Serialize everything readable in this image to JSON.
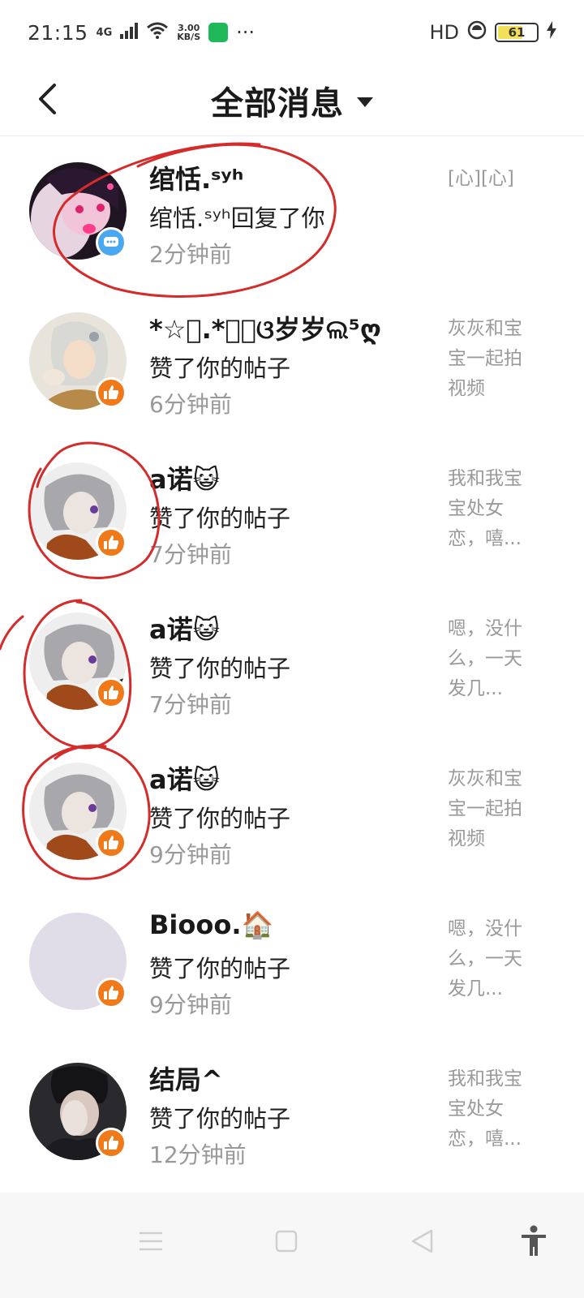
{
  "status_bar": {
    "time": "21:15",
    "network": "4G",
    "speed_value": "3.00",
    "speed_unit": "KB/S",
    "more": "···",
    "hd": "HD",
    "battery": "61"
  },
  "header": {
    "title": "全部消息"
  },
  "messages": [
    {
      "name": "绾恬.ˢʸʰ",
      "action": "绾恬.ˢʸʰ回复了你",
      "time": "2分钟前",
      "preview": "[心][心]",
      "badge": "comment-icon"
    },
    {
      "name": "*☆ﾟ.*･｡ଓ岁岁ଲ⁵ღ",
      "action": "赞了你的帖子",
      "time": "6分钟前",
      "preview": "灰灰和宝宝一起拍视频",
      "badge": "thumbs-up-icon"
    },
    {
      "name": "a诺😺",
      "action": "赞了你的帖子",
      "time": "7分钟前",
      "preview": "我和我宝宝处女恋，嘻...",
      "badge": "thumbs-up-icon"
    },
    {
      "name": "a诺😺",
      "action": "赞了你的帖子",
      "time": "7分钟前",
      "preview": "嗯，没什么，一天发几...",
      "badge": "thumbs-up-icon"
    },
    {
      "name": "a诺😺",
      "action": "赞了你的帖子",
      "time": "9分钟前",
      "preview": "灰灰和宝宝一起拍视频",
      "badge": "thumbs-up-icon"
    },
    {
      "name": "Biooo.🏠",
      "action": "赞了你的帖子",
      "time": "9分钟前",
      "preview": "嗯，没什么，一天发几...",
      "badge": "thumbs-up-icon"
    },
    {
      "name": "结局^",
      "action": "赞了你的帖子",
      "time": "12分钟前",
      "preview": "我和我宝宝处女恋，嘻...",
      "badge": "thumbs-up-icon"
    }
  ],
  "colors": {
    "like_badge": "#f07a1a",
    "comment_badge": "#4aa8f0",
    "annotation": "#d42b2b"
  }
}
